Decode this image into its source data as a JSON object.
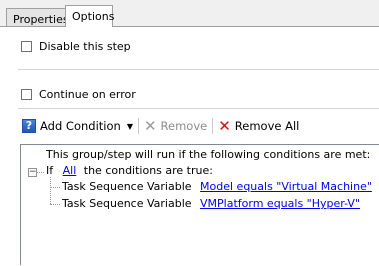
{
  "tabs": [
    {
      "label": "Properties"
    },
    {
      "label": "Options"
    }
  ],
  "options": {
    "disable_step_label": "Disable this step",
    "continue_on_error_label": "Continue on error"
  },
  "toolbar": {
    "add_condition_label": "Add Condition",
    "remove_label": "Remove",
    "remove_all_label": "Remove All"
  },
  "conditions": {
    "intro": "This group/step will run if the following conditions are met:",
    "group": {
      "prefix": "If",
      "operator": "All",
      "suffix": "the conditions are true:"
    },
    "items": [
      {
        "type": "Task Sequence Variable",
        "expression": "Model equals \"Virtual Machine\""
      },
      {
        "type": "Task Sequence Variable",
        "expression": "VMPlatform equals \"Hyper-V\""
      }
    ]
  }
}
